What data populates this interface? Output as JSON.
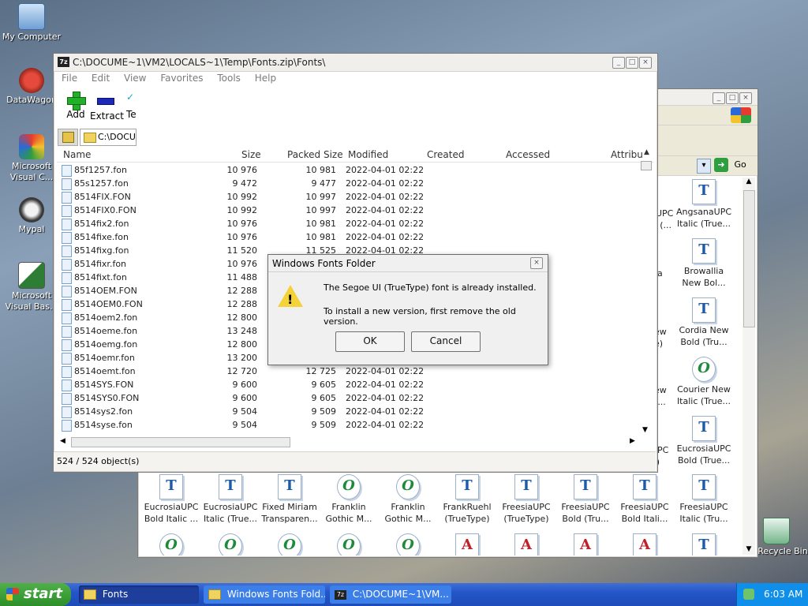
{
  "desktop": {
    "icons": [
      {
        "label": "My Computer"
      },
      {
        "label": "DataWagon"
      },
      {
        "label": "Microsoft Visual C..."
      },
      {
        "label": "Mypal"
      },
      {
        "label": "Microsoft Visual Bas..."
      },
      {
        "label": "Recycle Bin"
      }
    ]
  },
  "main_window": {
    "title": "C:\\DOCUME~1\\VM2\\LOCALS~1\\Temp\\Fonts.zip\\Fonts\\",
    "menu": [
      "File",
      "Edit",
      "View",
      "Favorites",
      "Tools",
      "Help"
    ],
    "toolbar": {
      "add": "Add",
      "extract": "Extract",
      "test": "Te"
    },
    "address": "C:\\DOCU",
    "columns": [
      "Name",
      "Size",
      "Packed Size",
      "Modified",
      "Created",
      "Accessed",
      "Attribu"
    ],
    "rows": [
      {
        "name": "85f1257.fon",
        "size": "10 976",
        "packed": "10 981",
        "modified": "2022-04-01 02:22"
      },
      {
        "name": "85s1257.fon",
        "size": "9 472",
        "packed": "9 477",
        "modified": "2022-04-01 02:22"
      },
      {
        "name": "8514FIX.FON",
        "size": "10 992",
        "packed": "10 997",
        "modified": "2022-04-01 02:22"
      },
      {
        "name": "8514FIX0.FON",
        "size": "10 992",
        "packed": "10 997",
        "modified": "2022-04-01 02:22"
      },
      {
        "name": "8514fix2.fon",
        "size": "10 976",
        "packed": "10 981",
        "modified": "2022-04-01 02:22"
      },
      {
        "name": "8514fixe.fon",
        "size": "10 976",
        "packed": "10 981",
        "modified": "2022-04-01 02:22"
      },
      {
        "name": "8514fixg.fon",
        "size": "11 520",
        "packed": "11 525",
        "modified": "2022-04-01 02:22"
      },
      {
        "name": "8514fixr.fon",
        "size": "10 976",
        "packed": "",
        "modified": ""
      },
      {
        "name": "8514fixt.fon",
        "size": "11 488",
        "packed": "",
        "modified": ""
      },
      {
        "name": "8514OEM.FON",
        "size": "12 288",
        "packed": "",
        "modified": ""
      },
      {
        "name": "8514OEM0.FON",
        "size": "12 288",
        "packed": "",
        "modified": ""
      },
      {
        "name": "8514oem2.fon",
        "size": "12 800",
        "packed": "",
        "modified": ""
      },
      {
        "name": "8514oeme.fon",
        "size": "13 248",
        "packed": "",
        "modified": ""
      },
      {
        "name": "8514oemg.fon",
        "size": "12 800",
        "packed": "",
        "modified": ""
      },
      {
        "name": "8514oemr.fon",
        "size": "13 200",
        "packed": "",
        "modified": ""
      },
      {
        "name": "8514oemt.fon",
        "size": "12 720",
        "packed": "12 725",
        "modified": "2022-04-01 02:22"
      },
      {
        "name": "8514SYS.FON",
        "size": "9 600",
        "packed": "9 605",
        "modified": "2022-04-01 02:22"
      },
      {
        "name": "8514SYS0.FON",
        "size": "9 600",
        "packed": "9 605",
        "modified": "2022-04-01 02:22"
      },
      {
        "name": "8514sys2.fon",
        "size": "9 504",
        "packed": "9 509",
        "modified": "2022-04-01 02:22"
      },
      {
        "name": "8514syse.fon",
        "size": "9 504",
        "packed": "9 509",
        "modified": "2022-04-01 02:22"
      }
    ],
    "status": "524 / 524 object(s)"
  },
  "fonts_window": {
    "go_label": "Go",
    "right_column": [
      {
        "label": "AngsanaUPC Italic (True...",
        "kind": "tt",
        "glyph": "T"
      },
      {
        "label": "Browallia New Bol...",
        "kind": "tt",
        "glyph": "T"
      },
      {
        "label": "Cordia New Bold (Tru...",
        "kind": "tt",
        "glyph": "T"
      },
      {
        "label": "Courier New Italic (True...",
        "kind": "ot",
        "glyph": "O"
      },
      {
        "label": "EucrosiaUPC Bold (True...",
        "kind": "tt",
        "glyph": "T"
      }
    ],
    "left_partial": [
      "UPC (...",
      "a",
      "ew e)",
      "ew t...",
      "UPC e)"
    ],
    "bottom_row": [
      {
        "label": "EucrosiaUPC Bold Italic ...",
        "kind": "tt",
        "glyph": "T"
      },
      {
        "label": "EucrosiaUPC Italic (True...",
        "kind": "tt",
        "glyph": "T"
      },
      {
        "label": "Fixed Miriam Transparen...",
        "kind": "tt",
        "glyph": "T"
      },
      {
        "label": "Franklin Gothic M...",
        "kind": "ot",
        "glyph": "O"
      },
      {
        "label": "Franklin Gothic M...",
        "kind": "ot",
        "glyph": "O"
      },
      {
        "label": "FrankRuehl (TrueType)",
        "kind": "tt",
        "glyph": "T"
      },
      {
        "label": "FreesiaUPC (TrueType)",
        "kind": "tt",
        "glyph": "T"
      },
      {
        "label": "FreesiaUPC Bold (Tru...",
        "kind": "tt",
        "glyph": "T"
      },
      {
        "label": "FreesiaUPC Bold Itali...",
        "kind": "tt",
        "glyph": "T"
      },
      {
        "label": "FreesiaUPC Italic (Tru...",
        "kind": "tt",
        "glyph": "T"
      }
    ],
    "last_row": [
      {
        "kind": "ot",
        "glyph": "O"
      },
      {
        "kind": "ot",
        "glyph": "O"
      },
      {
        "kind": "ot",
        "glyph": "O"
      },
      {
        "kind": "ot",
        "glyph": "O"
      },
      {
        "kind": "ot",
        "glyph": "O"
      },
      {
        "kind": "ra",
        "glyph": "A"
      },
      {
        "kind": "ra",
        "glyph": "A"
      },
      {
        "kind": "ra",
        "glyph": "A"
      },
      {
        "kind": "ra",
        "glyph": "A"
      },
      {
        "kind": "tt",
        "glyph": "T"
      }
    ]
  },
  "dialog": {
    "title": "Windows Fonts Folder",
    "message1": "The Segoe UI (TrueType) font is already installed.",
    "message2": "To install a new version, first remove the old version.",
    "ok": "OK",
    "cancel": "Cancel"
  },
  "taskbar": {
    "start": "start",
    "tasks": [
      {
        "label": "Fonts",
        "active": true
      },
      {
        "label": "Windows Fonts Fold...",
        "active": false
      },
      {
        "label": "C:\\DOCUME~1\\VM...",
        "active": false
      }
    ],
    "clock": "6:03 AM"
  },
  "colors": {
    "taskbar": "#2456c8",
    "start": "#2e8f2a",
    "tray": "#0f8fe9"
  }
}
